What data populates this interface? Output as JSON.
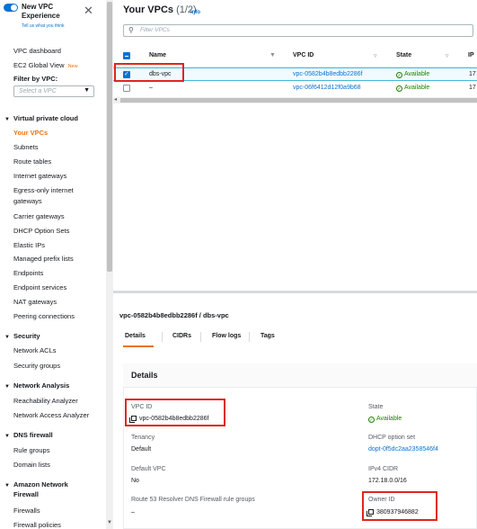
{
  "sidebar": {
    "new_experience_title": "New VPC Experience",
    "tell_us": "Tell us what you think",
    "close_glyph": "✕",
    "vpc_dashboard": "VPC dashboard",
    "ec2_global_view": "EC2 Global View",
    "new_badge": "New",
    "filter_by_vpc": "Filter by VPC:",
    "select_vpc_placeholder": "Select a VPC",
    "virtual_private_cloud": "Virtual private cloud",
    "vpc_items": [
      "Your VPCs",
      "Subnets",
      "Route tables",
      "Internet gateways",
      "Egress-only internet",
      "gateways",
      "Carrier gateways",
      "DHCP Option Sets",
      "Elastic IPs",
      "Managed prefix lists",
      "Endpoints",
      "Endpoint services",
      "NAT gateways",
      "Peering connections"
    ],
    "security": "Security",
    "security_items": [
      "Network ACLs",
      "Security groups"
    ],
    "network_analysis": "Network Analysis",
    "network_analysis_items": [
      "Reachability Analyzer",
      "Network Access Analyzer"
    ],
    "dns_firewall": "DNS firewall",
    "dns_items": [
      "Rule groups",
      "Domain lists"
    ],
    "amazon_network_firewall_1": "Amazon Network",
    "amazon_network_firewall_2": "Firewall",
    "anf_items": [
      "Firewalls",
      "Firewall policies"
    ]
  },
  "vpcs": {
    "title": "Your VPCs",
    "count": "(1/2)",
    "info": "Info",
    "filter_placeholder": "Filter VPCs",
    "columns": [
      "Name",
      "VPC ID",
      "State",
      "IP"
    ],
    "rows": [
      {
        "name": "dbs-vpc",
        "vpc_id": "vpc-0582b4b8edbb2286f",
        "state": "Available",
        "ipv4": "17",
        "selected": true
      },
      {
        "name": "–",
        "vpc_id": "vpc-06f6412d12f0a9b68",
        "state": "Available",
        "ipv4": "17",
        "selected": false
      }
    ]
  },
  "detail": {
    "heading": "vpc-0582b4b8edbb2286f / dbs-vpc",
    "tabs": [
      "Details",
      "CIDRs",
      "Flow logs",
      "Tags"
    ],
    "card_title": "Details",
    "vpc_id_label": "VPC ID",
    "vpc_id_value": "vpc-0582b4b8edbb2286f",
    "tenancy_label": "Tenancy",
    "tenancy_value": "Default",
    "default_vpc_label": "Default VPC",
    "default_vpc_value": "No",
    "route53_label": "Route 53 Resolver DNS Firewall rule groups",
    "route53_value": "–",
    "state_label": "State",
    "state_value": "Available",
    "dhcp_label": "DHCP option set",
    "dhcp_value": "dopt-0f5dc2aa2358546f4",
    "ipv4_label": "IPv4 CIDR",
    "ipv4_value": "172.18.0.0/16",
    "owner_label": "Owner ID",
    "owner_value": "380937946882"
  },
  "colors": {
    "accent": "#ec7211",
    "link": "#0972d3",
    "success": "#1d8102",
    "highlight": "#e0261b"
  }
}
